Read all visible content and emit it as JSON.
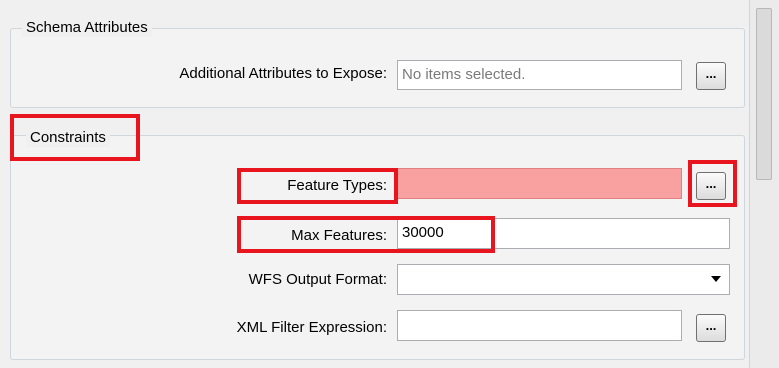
{
  "schema_attributes": {
    "group_title": "Schema Attributes",
    "additional_attributes_label": "Additional Attributes to Expose:",
    "additional_attributes_placeholder": "No items selected.",
    "browse_button_label": "..."
  },
  "constraints": {
    "group_title": "Constraints",
    "feature_types_label": "Feature Types:",
    "feature_types_value": "",
    "feature_types_button_label": "...",
    "max_features_label": "Max Features:",
    "max_features_value": "30000",
    "wfs_output_format_label": "WFS Output Format:",
    "wfs_output_format_value": "",
    "xml_filter_label": "XML Filter Expression:",
    "xml_filter_value": "",
    "xml_filter_button_label": "..."
  },
  "colors": {
    "highlight": "#e8141e",
    "feature_types_field_bg": "#f9a0a0"
  }
}
